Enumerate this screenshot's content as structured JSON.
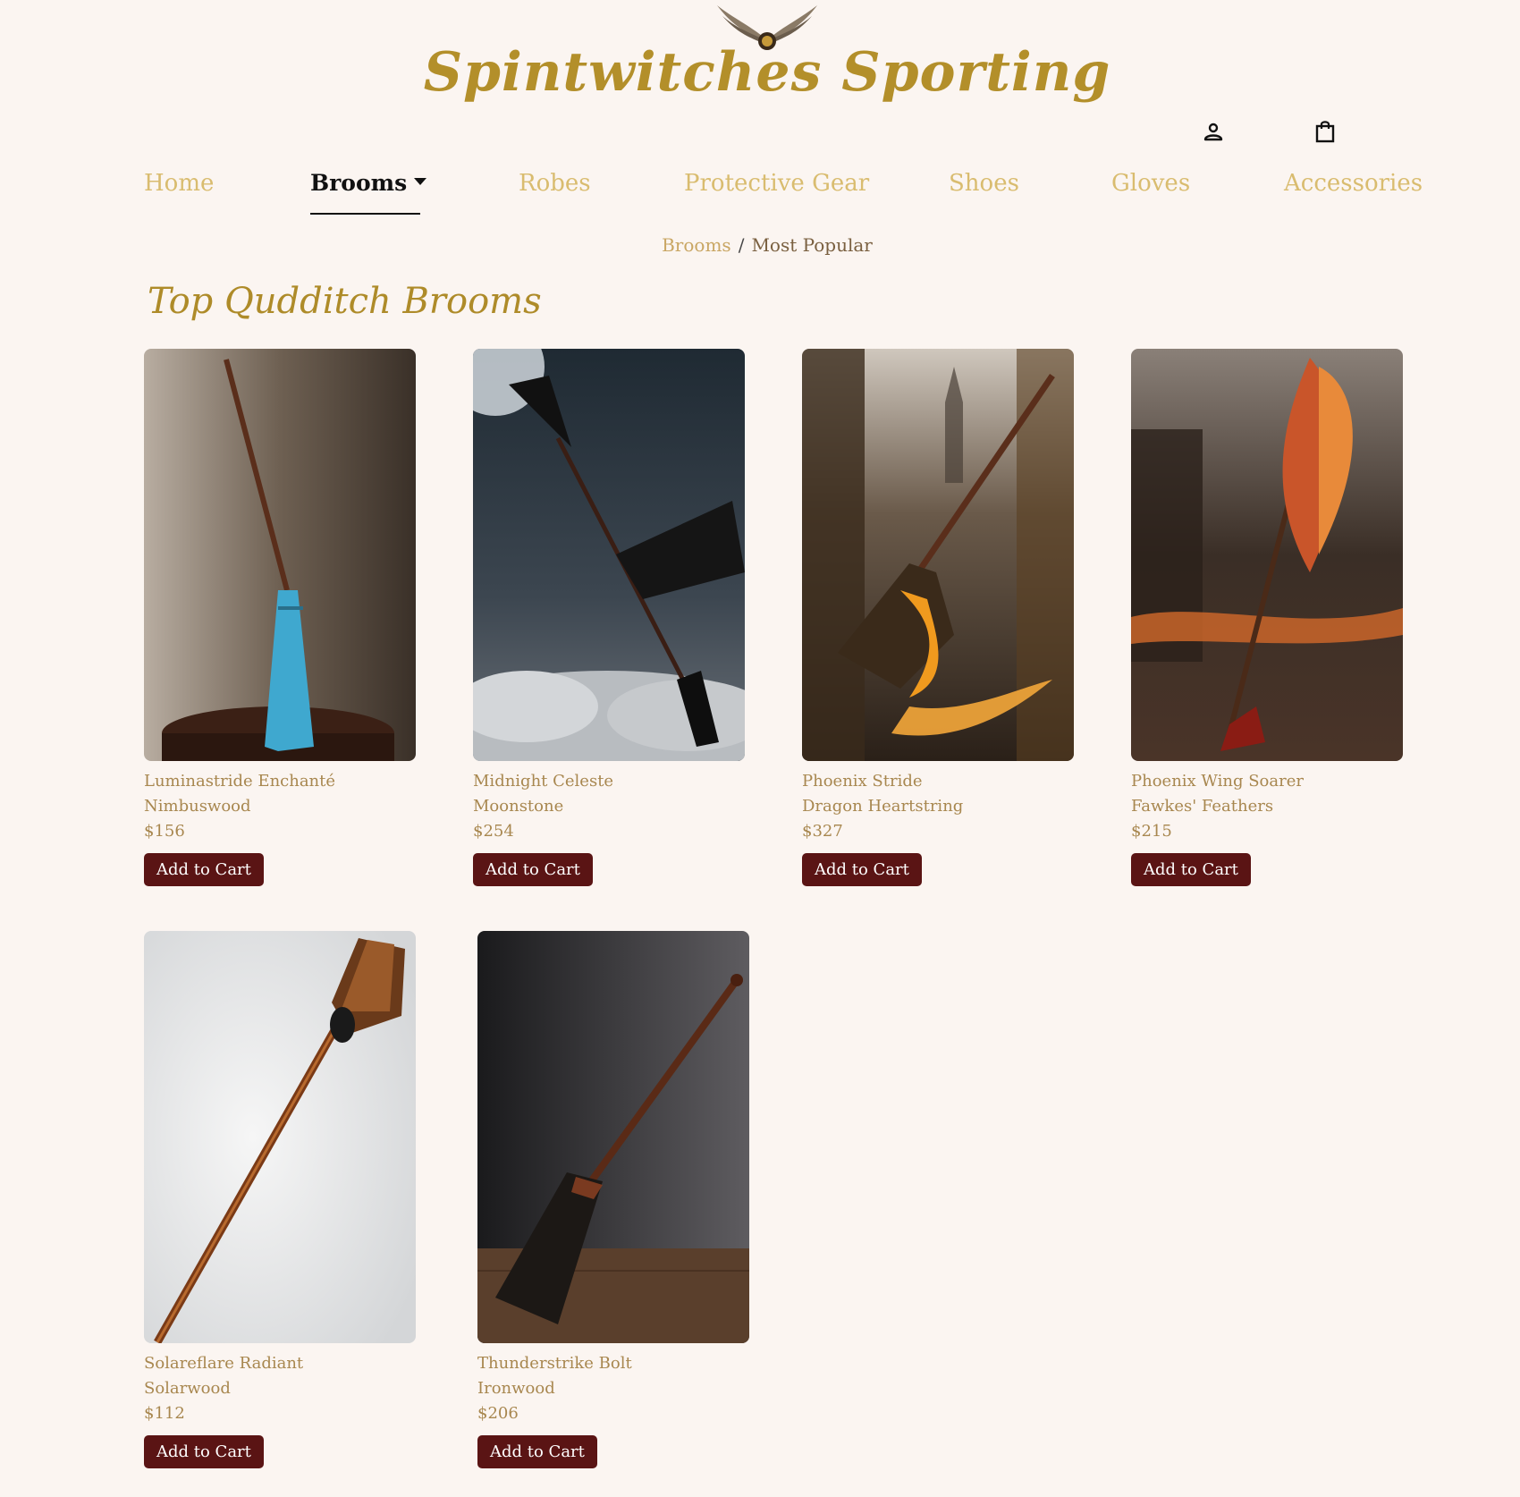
{
  "site": {
    "brand": "Spintwitches Sporting"
  },
  "nav": {
    "items": [
      {
        "label": "Home"
      },
      {
        "label": "Brooms"
      },
      {
        "label": "Robes"
      },
      {
        "label": "Protective Gear"
      },
      {
        "label": "Shoes"
      },
      {
        "label": "Gloves"
      },
      {
        "label": "Accessories"
      }
    ],
    "active": "Brooms"
  },
  "header_icons": {
    "account": "user-icon",
    "cart": "shopping-bag-icon"
  },
  "breadcrumb": {
    "parent": "Brooms",
    "separator": "/",
    "current": "Most Popular"
  },
  "page": {
    "title": "Top Qudditch Brooms"
  },
  "products": [
    {
      "name": "Luminastride Enchanté",
      "wood": "Nimbuswood",
      "price": "$156",
      "button": "Add to Cart"
    },
    {
      "name": "Midnight Celeste",
      "wood": "Moonstone",
      "price": "$254",
      "button": "Add to Cart"
    },
    {
      "name": "Phoenix Stride",
      "wood": "Dragon Heartstring",
      "price": "$327",
      "button": "Add to Cart"
    },
    {
      "name": "Phoenix Wing Soarer",
      "wood": "Fawkes' Feathers",
      "price": "$215",
      "button": "Add to Cart"
    },
    {
      "name": "Solareflare Radiant",
      "wood": "Solarwood",
      "price": "$112",
      "button": "Add to Cart"
    },
    {
      "name": "Thunderstrike Bolt",
      "wood": "Ironwood",
      "price": "$206",
      "button": "Add to Cart"
    }
  ],
  "colors": {
    "background": "#fbf5f1",
    "brand_gold": "#b38f2a",
    "nav_inactive": "#d9bc6f",
    "button_bg": "#5a1414",
    "product_text": "#a8874f"
  }
}
